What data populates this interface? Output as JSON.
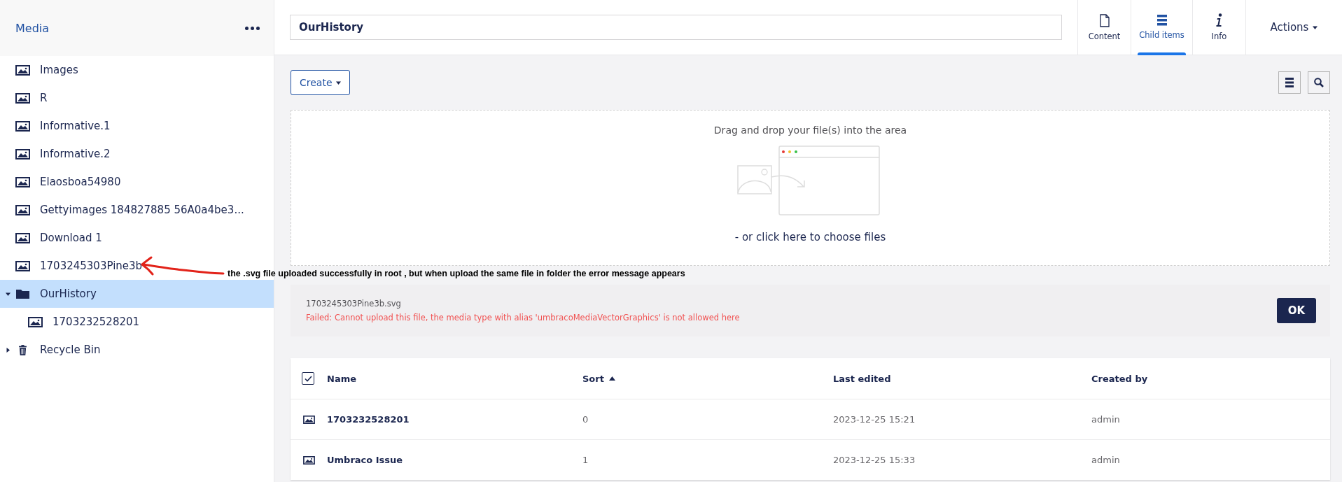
{
  "sidebar": {
    "title": "Media",
    "tree": [
      {
        "label": "Images",
        "kind": "image",
        "selected": false
      },
      {
        "label": "R",
        "kind": "image",
        "selected": false
      },
      {
        "label": "Informative.1",
        "kind": "image",
        "selected": false
      },
      {
        "label": "Informative.2",
        "kind": "image",
        "selected": false
      },
      {
        "label": "Elaosboa54980",
        "kind": "image",
        "selected": false
      },
      {
        "label": "Gettyimages 184827885 56A0a4be3...",
        "kind": "image",
        "selected": false
      },
      {
        "label": "Download 1",
        "kind": "image",
        "selected": false
      },
      {
        "label": "1703245303Pine3b",
        "kind": "image",
        "selected": false
      },
      {
        "label": "OurHistory",
        "kind": "folder",
        "selected": true,
        "expanded": true,
        "children": [
          {
            "label": "1703232528201",
            "kind": "image",
            "selected": false
          }
        ]
      },
      {
        "label": "Recycle Bin",
        "kind": "trash",
        "selected": false,
        "expanded": false
      }
    ]
  },
  "annotation": {
    "text": "the .svg file uploaded successfully in root , but when upload the same file in folder the error message appears"
  },
  "header": {
    "name_value": "OurHistory",
    "tabs": [
      {
        "label": "Content",
        "kind": "document",
        "selected": false
      },
      {
        "label": "Child items",
        "kind": "list",
        "selected": true
      },
      {
        "label": "Info",
        "kind": "info",
        "selected": false
      }
    ],
    "actions": "Actions"
  },
  "toolbar": {
    "create": "Create"
  },
  "dropzone": {
    "title": "Drag and drop your file(s) into the area",
    "link": "- or click here to choose files"
  },
  "upload_error": {
    "file": "1703245303Pine3b.svg",
    "message": "Failed: Cannot upload this file, the media type with alias 'umbracoMediaVectorGraphics' is not allowed here",
    "button": "OK"
  },
  "table": {
    "all_checked": true,
    "columns": [
      {
        "label": "Name",
        "sorted": false
      },
      {
        "label": "Sort",
        "sorted": true
      },
      {
        "label": "Last edited",
        "sorted": false
      },
      {
        "label": "Created by",
        "sorted": false
      }
    ],
    "rows": [
      {
        "cells": [
          "1703232528201",
          "0",
          "2023-12-25 15:21",
          "admin"
        ]
      },
      {
        "cells": [
          "Umbraco Issue",
          "1",
          "2023-12-25 15:33",
          "admin"
        ]
      }
    ]
  }
}
